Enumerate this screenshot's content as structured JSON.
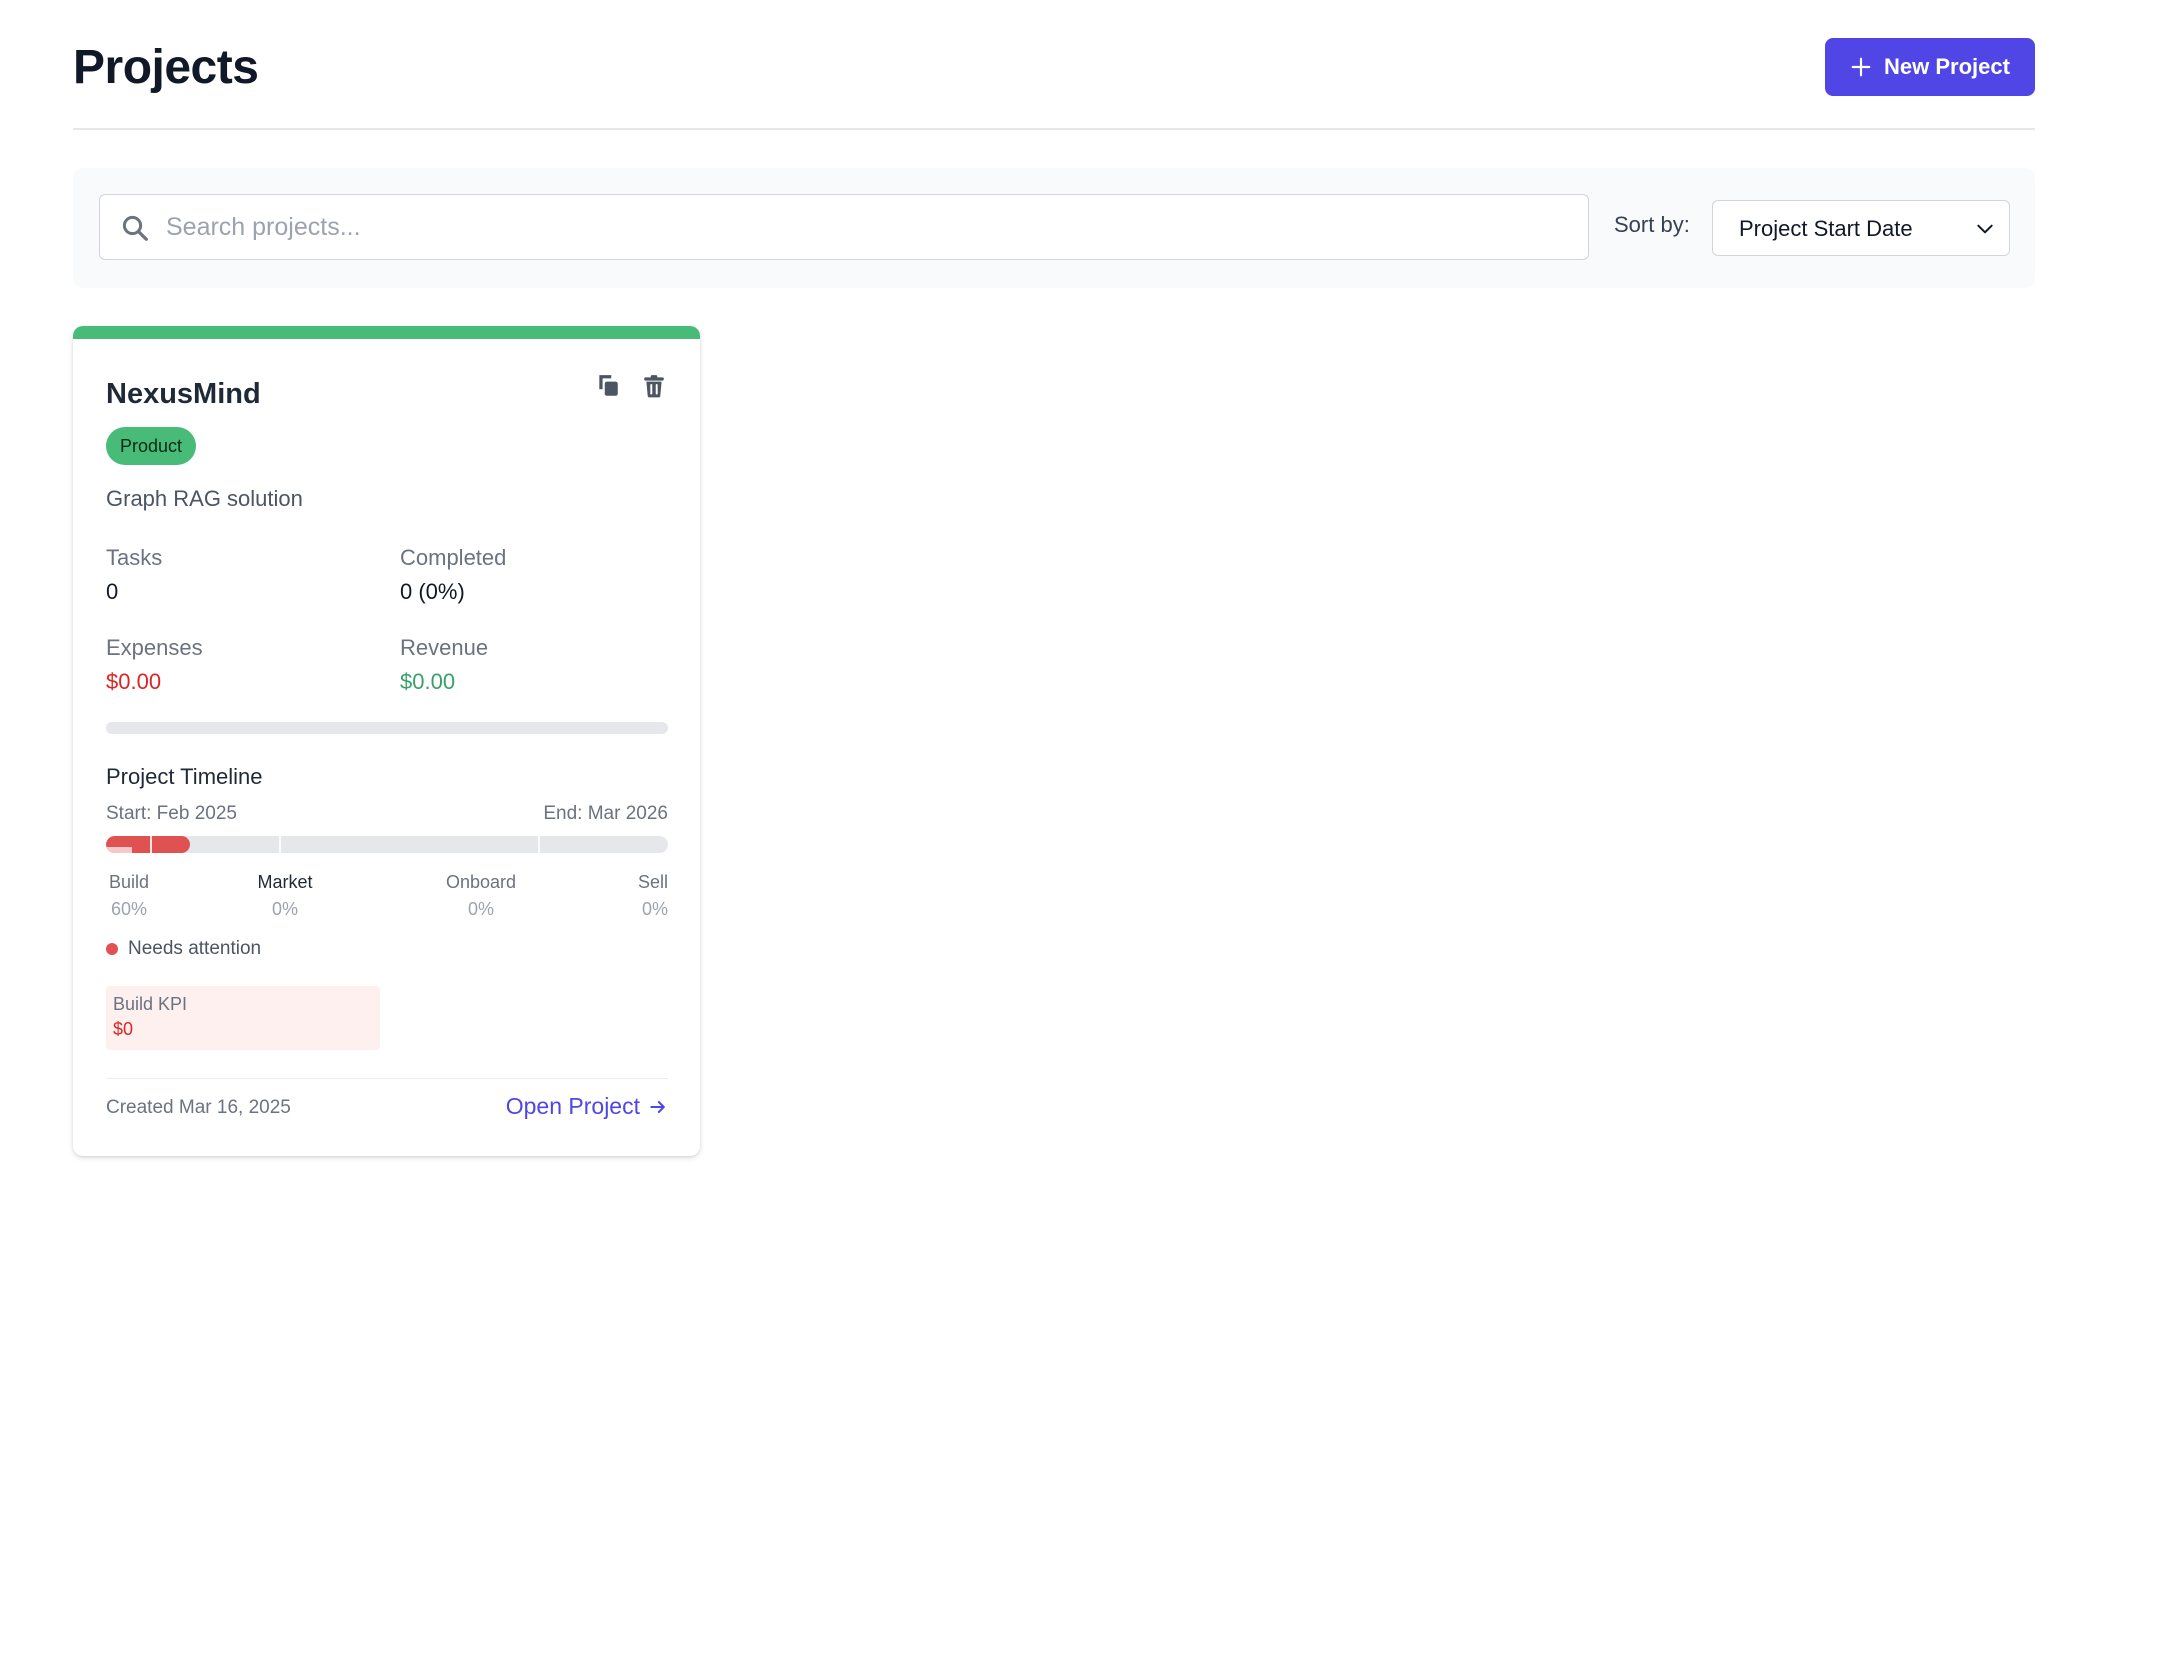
{
  "header": {
    "title": "Projects",
    "new_project_label": "New Project"
  },
  "toolbar": {
    "search_placeholder": "Search projects...",
    "search_value": "",
    "sort_label": "Sort by:",
    "sort_value": "Project Start Date"
  },
  "colors": {
    "accent": "#4f46e5",
    "category_green": "#48bb78",
    "expense_red": "#dc2626",
    "revenue_green": "#38a169",
    "attention_red": "#e05252"
  },
  "projects": [
    {
      "name": "NexusMind",
      "category": "Product",
      "description": "Graph RAG solution",
      "stats": {
        "tasks_label": "Tasks",
        "tasks_value": "0",
        "completed_label": "Completed",
        "completed_value": "0 (0%)",
        "expenses_label": "Expenses",
        "expenses_value": "$0.00",
        "revenue_label": "Revenue",
        "revenue_value": "$0.00"
      },
      "progress_fraction": 0,
      "timeline": {
        "title": "Project Timeline",
        "start_label": "Start: Feb 2025",
        "end_label": "End: Mar 2026",
        "elapsed_fraction": 0.15,
        "phases": [
          {
            "name": "Build",
            "value": "60%"
          },
          {
            "name": "Market",
            "value": "0%"
          },
          {
            "name": "Onboard",
            "value": "0%"
          },
          {
            "name": "Sell",
            "value": "0%"
          }
        ]
      },
      "status_text": "Needs attention",
      "kpi": {
        "label": "Build KPI",
        "value": "$0"
      },
      "created_text": "Created Mar 16, 2025",
      "open_label": "Open Project"
    }
  ],
  "icons": {
    "new_project": "plus-icon",
    "search": "search-icon",
    "sort": "chevron-down-icon",
    "duplicate": "copy-icon",
    "delete": "trash-icon",
    "open": "arrow-right-icon"
  }
}
